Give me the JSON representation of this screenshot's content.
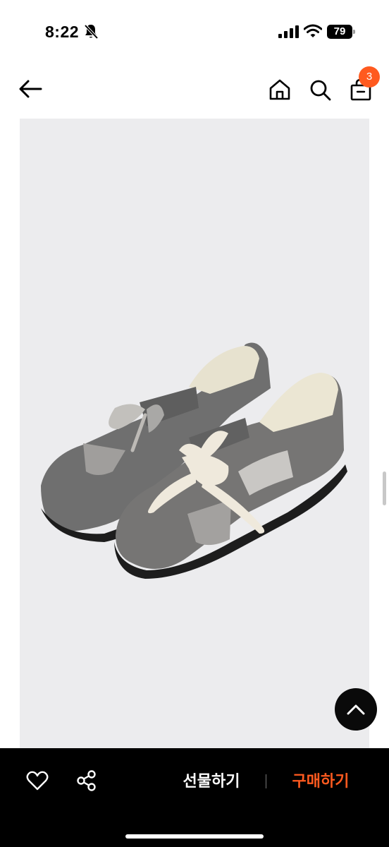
{
  "status_bar": {
    "time": "8:22",
    "battery_level": "79",
    "icons": [
      "bell-slash-icon",
      "signal-icon",
      "wifi-icon",
      "battery-icon"
    ]
  },
  "nav": {
    "icons": [
      "back-arrow-icon",
      "home-icon",
      "search-icon",
      "cart-icon"
    ],
    "cart_count": "3"
  },
  "product": {
    "image_background": "#ececee",
    "image_subject": "shoes"
  },
  "bottom_bar": {
    "gift_label": "선물하기",
    "buy_label": "구매하기",
    "icons": [
      "heart-icon",
      "share-icon"
    ]
  },
  "colors": {
    "accent": "#ff5a1f",
    "bar_background": "#000000"
  }
}
